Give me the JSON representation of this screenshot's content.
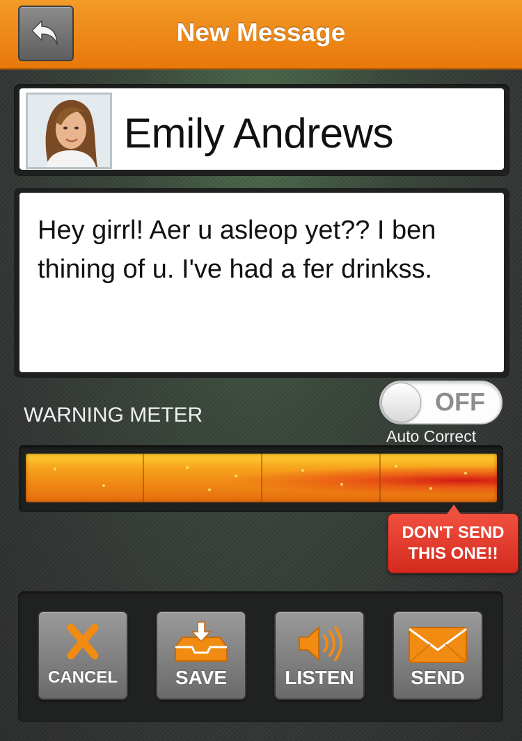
{
  "header": {
    "title": "New Message",
    "back_icon": "back-arrow-icon",
    "background_color": "#ef8a1a"
  },
  "recipient": {
    "name": "Emily Andrews",
    "avatar_icon": "contact-photo"
  },
  "message": {
    "text": "Hey girrl! Aer u asleop yet?? I ben thining of u. I've had a fer drinkss."
  },
  "warning_meter": {
    "label": "WARNING METER",
    "level_percent": 95,
    "segments": 4,
    "warning_text_line1": "DON'T SEND",
    "warning_text_line2": "THIS ONE!!",
    "warning_color": "#e03a2b"
  },
  "auto_correct": {
    "state": "OFF",
    "caption": "Auto Correct"
  },
  "actions": [
    {
      "label": "CANCEL",
      "icon": "x-icon"
    },
    {
      "label": "SAVE",
      "icon": "inbox-download-icon"
    },
    {
      "label": "LISTEN",
      "icon": "speaker-icon"
    },
    {
      "label": "SEND",
      "icon": "envelope-icon"
    }
  ],
  "colors": {
    "accent": "#f08a14",
    "panel": "#1f2120"
  }
}
